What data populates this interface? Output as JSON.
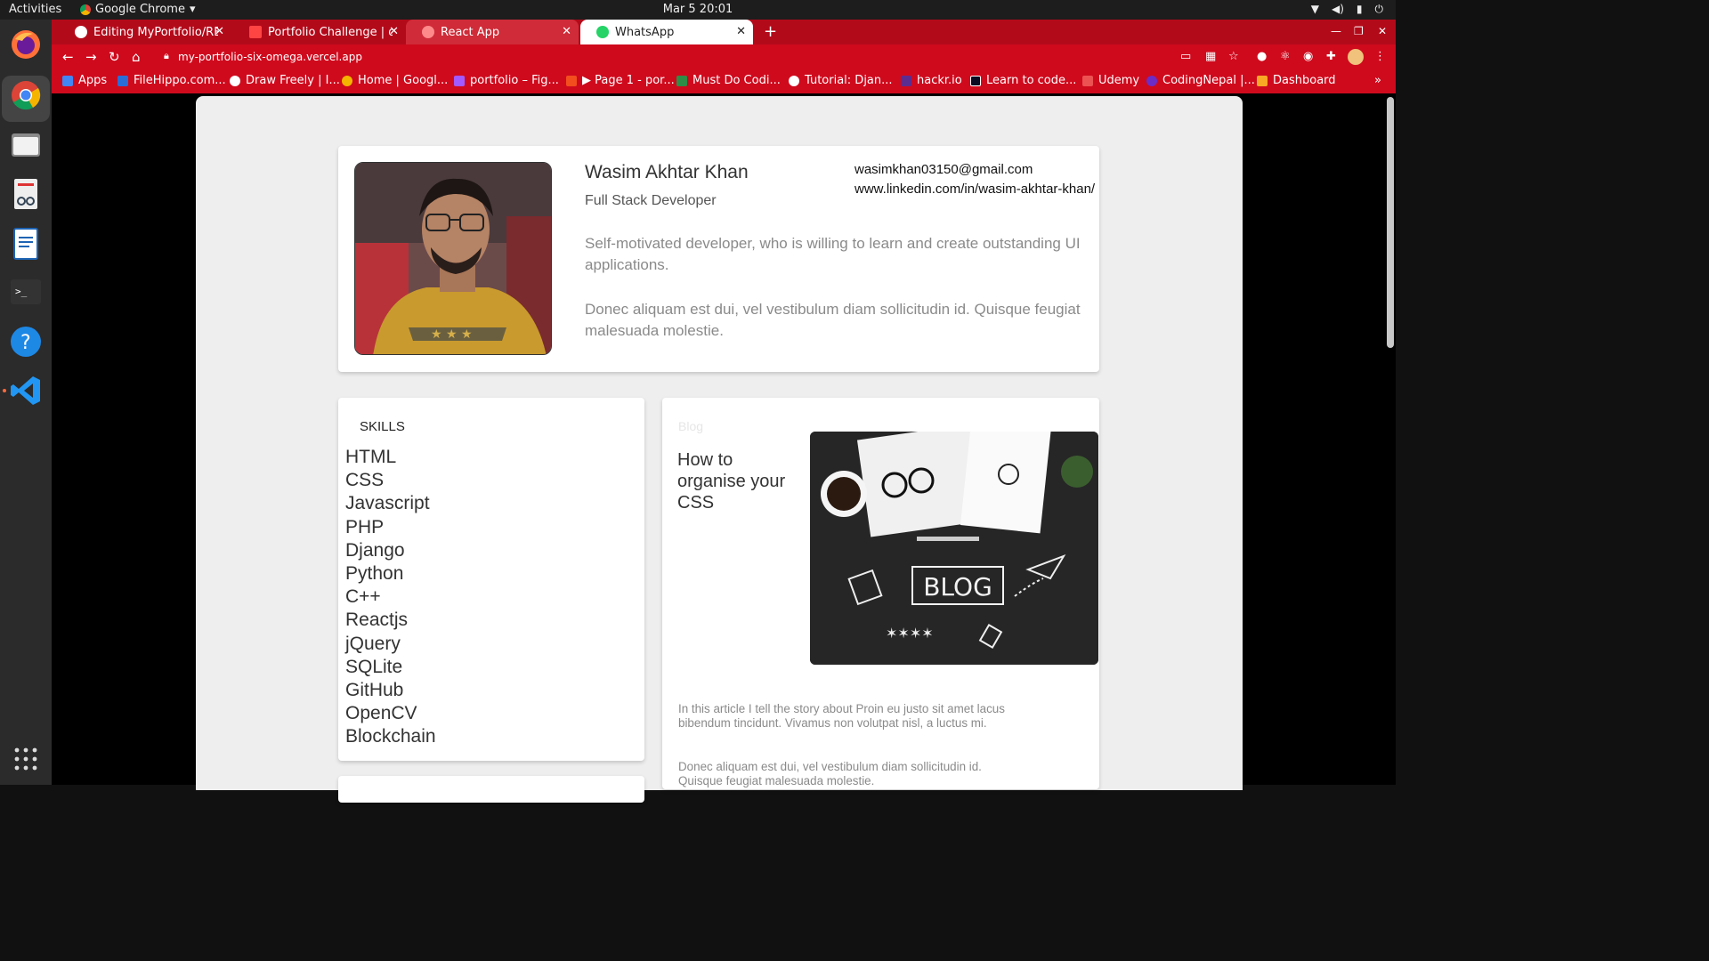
{
  "os": {
    "activities": "Activities",
    "app_name": "Google Chrome",
    "clock": "Mar 5  20:01"
  },
  "browser": {
    "tabs": [
      {
        "label": "Editing MyPortfolio/REA",
        "fav_color": "#ffffff"
      },
      {
        "label": "Portfolio Challenge | dev",
        "fav_color": "#ff4444"
      },
      {
        "label": "React App",
        "fav_color": "#ff6a6a"
      },
      {
        "label": "WhatsApp",
        "fav_color": "#25d366"
      }
    ],
    "url": "my-portfolio-six-omega.vercel.app",
    "bookmarks": [
      {
        "label": "Apps",
        "color": "#4285f4"
      },
      {
        "label": "FileHippo.com...",
        "color": "#2a6dd9"
      },
      {
        "label": "Draw Freely | I...",
        "color": "#ffffff"
      },
      {
        "label": "Home | Googl...",
        "color": "#f4b400"
      },
      {
        "label": "portfolio – Fig...",
        "color": "#a259ff"
      },
      {
        "label": "▶ Page 1 - por...",
        "color": "#f24e1e"
      },
      {
        "label": "Must Do Codi...",
        "color": "#2f8d46"
      },
      {
        "label": "Tutorial: Djan...",
        "color": "#ffffff"
      },
      {
        "label": "hackr.io",
        "color": "#5b2d90"
      },
      {
        "label": "Learn to code...",
        "color": "#0a0a23"
      },
      {
        "label": "Udemy",
        "color": "#ec5252"
      },
      {
        "label": "CodingNepal |...",
        "color": "#6c2dc7"
      },
      {
        "label": "Dashboard",
        "color": "#f9a825"
      }
    ],
    "accent": "#cf0a1d"
  },
  "profile": {
    "name": "Wasim Akhtar Khan",
    "role": "Full Stack Developer",
    "email": "wasimkhan03150@gmail.com",
    "linkedin": "www.linkedin.com/in/wasim-akhtar-khan/",
    "bio1": "Self-motivated developer, who is willing to learn and create outstanding UI applications.",
    "bio2": "Donec aliquam est dui, vel vestibulum diam sollicitudin id. Quisque feugiat malesuada molestie."
  },
  "skills": {
    "title": "SKILLS",
    "items": [
      "HTML",
      "CSS",
      "Javascript",
      "PHP",
      "Django",
      "Python",
      "C++",
      "Reactjs",
      "jQuery",
      "SQLite",
      "GitHub",
      "OpenCV",
      "Blockchain"
    ]
  },
  "blog": {
    "label": "Blog",
    "title": "How to organise your CSS",
    "image_text": "BLOG",
    "text1": "In this article I tell the story about Proin eu justo sit amet lacus bibendum tincidunt. Vivamus non volutpat nisl, a luctus mi.",
    "text2": "Donec aliquam est dui, vel vestibulum diam sollicitudin id. Quisque feugiat malesuada molestie."
  }
}
